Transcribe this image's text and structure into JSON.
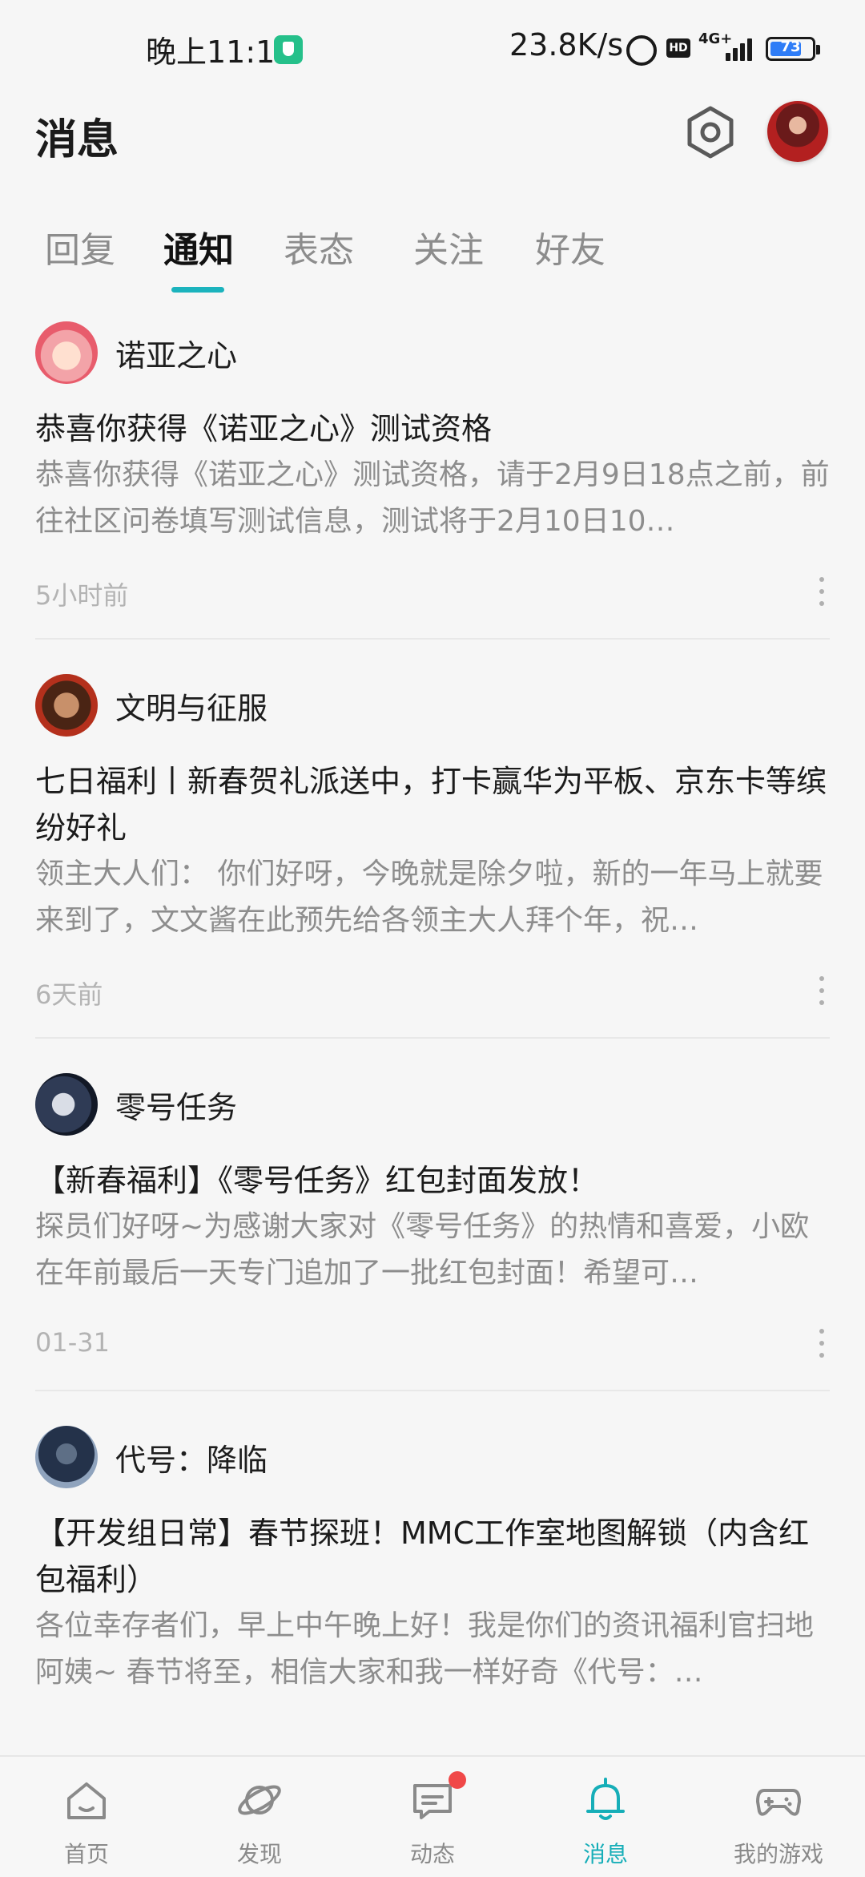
{
  "status_bar": {
    "time": "晚上11:12",
    "network_speed": "23.8K/s",
    "network_type": "4G+",
    "battery_level": "73"
  },
  "header": {
    "title": "消息"
  },
  "tabs": [
    {
      "label": "回复"
    },
    {
      "label": "通知"
    },
    {
      "label": "表态"
    },
    {
      "label": "关注"
    },
    {
      "label": "好友"
    }
  ],
  "active_tab": "通知",
  "notifications": [
    {
      "game": "诺亚之心",
      "title": "恭喜你获得《诺亚之心》测试资格",
      "body": "恭喜你获得《诺亚之心》测试资格，请于2月9日18点之前，前往社区问卷填写测试信息，测试将于2月10日10…",
      "time": "5小时前"
    },
    {
      "game": "文明与征服",
      "title": "七日福利丨新春贺礼派送中，打卡赢华为平板、京东卡等缤纷好礼",
      "body": "领主大人们： 你们好呀，今晚就是除夕啦，新的一年马上就要来到了，文文酱在此预先给各领主大人拜个年，祝…",
      "time": "6天前"
    },
    {
      "game": "零号任务",
      "title": "【新春福利】《零号任务》红包封面发放！",
      "body": "探员们好呀~为感谢大家对《零号任务》的热情和喜爱，小欧在年前最后一天专门追加了一批红包封面！希望可…",
      "time": "01-31"
    },
    {
      "game": "代号：降临",
      "title": "【开发组日常】春节探班！MMC工作室地图解锁（内含红包福利）",
      "body": "各位幸存者们，早上中午晚上好！我是你们的资讯福利官扫地阿姨~ 春节将至，相信大家和我一样好奇《代号：…",
      "time": ""
    }
  ],
  "bottom_nav": [
    {
      "label": "首页",
      "icon": "home-icon"
    },
    {
      "label": "发现",
      "icon": "planet-icon"
    },
    {
      "label": "动态",
      "icon": "chat-icon"
    },
    {
      "label": "消息",
      "icon": "bell-icon"
    },
    {
      "label": "我的游戏",
      "icon": "gamepad-icon"
    }
  ],
  "colors": {
    "accent": "#16aeb8",
    "badge": "#f04848",
    "background": "#f6f6f6"
  }
}
